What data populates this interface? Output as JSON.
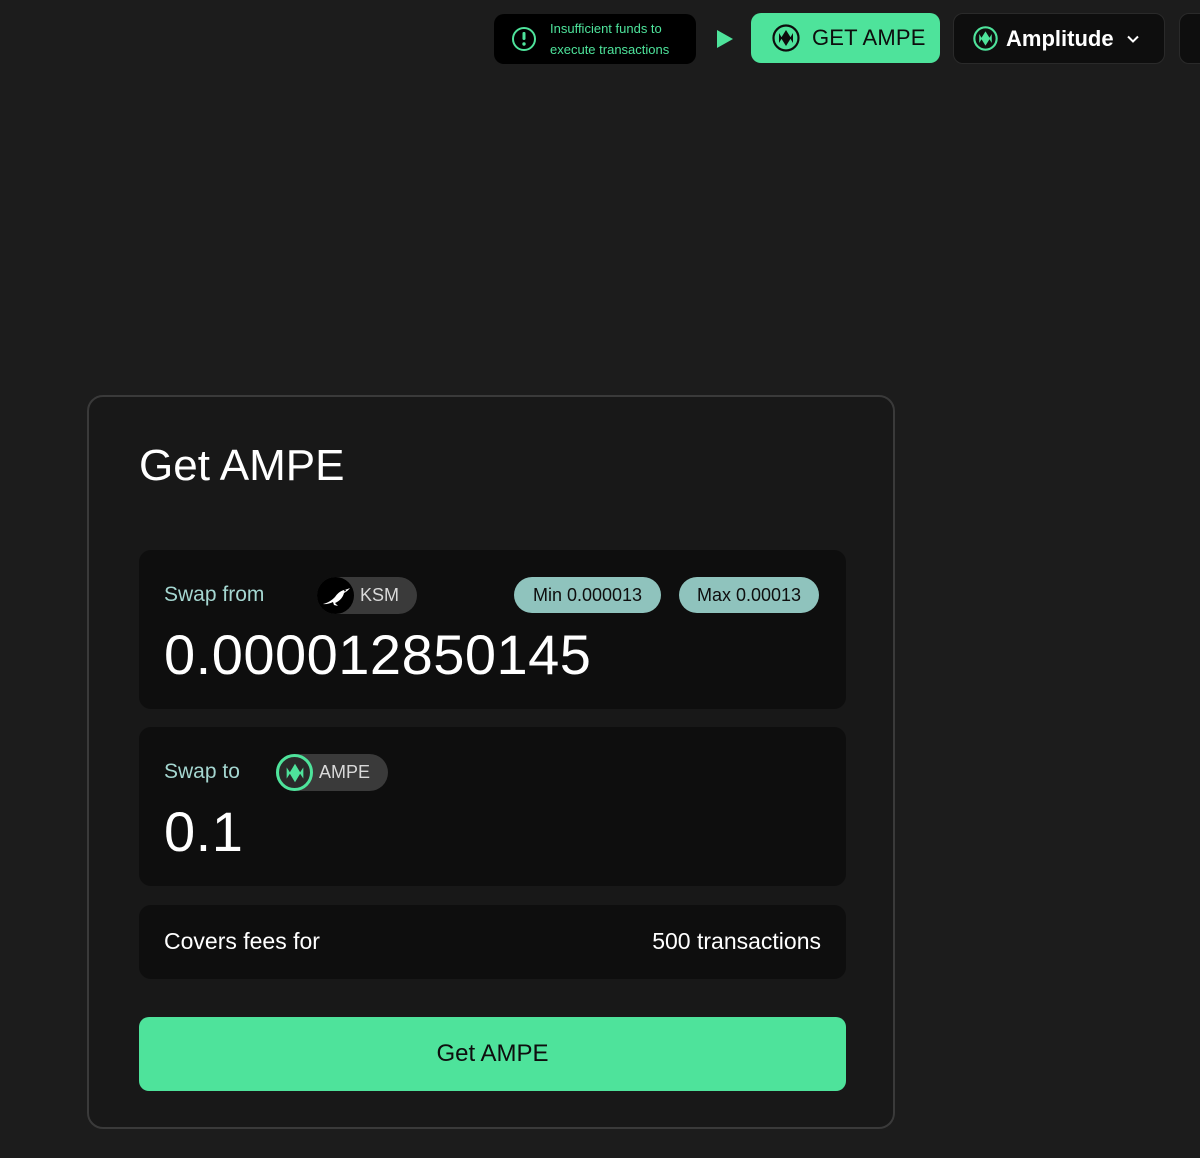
{
  "topbar": {
    "warning_line1": "Insufficient funds to",
    "warning_line2": "execute transactions",
    "get_button_label": "GET AMPE",
    "network_label": "Amplitude"
  },
  "card": {
    "title": "Get AMPE",
    "swap_from": {
      "label": "Swap from",
      "token": "KSM",
      "min_label": "Min 0.000013",
      "max_label": "Max 0.00013",
      "amount": "0.000012850145"
    },
    "swap_to": {
      "label": "Swap to",
      "token": "AMPE",
      "amount": "0.1"
    },
    "fees": {
      "label": "Covers fees for",
      "value": "500 transactions"
    },
    "submit_label": "Get AMPE"
  },
  "colors": {
    "accent": "#4ee39b",
    "background": "#1c1c1c",
    "panel": "#0e0e0e",
    "pill": "#8fc3bd",
    "label_teal": "#a4d6d0"
  },
  "icons": {
    "warning": "exclamation-circle-icon",
    "play": "play-triangle-icon",
    "ampe": "amplitude-logo-icon",
    "ksm": "kusama-bird-icon",
    "chevron": "chevron-down-icon"
  }
}
